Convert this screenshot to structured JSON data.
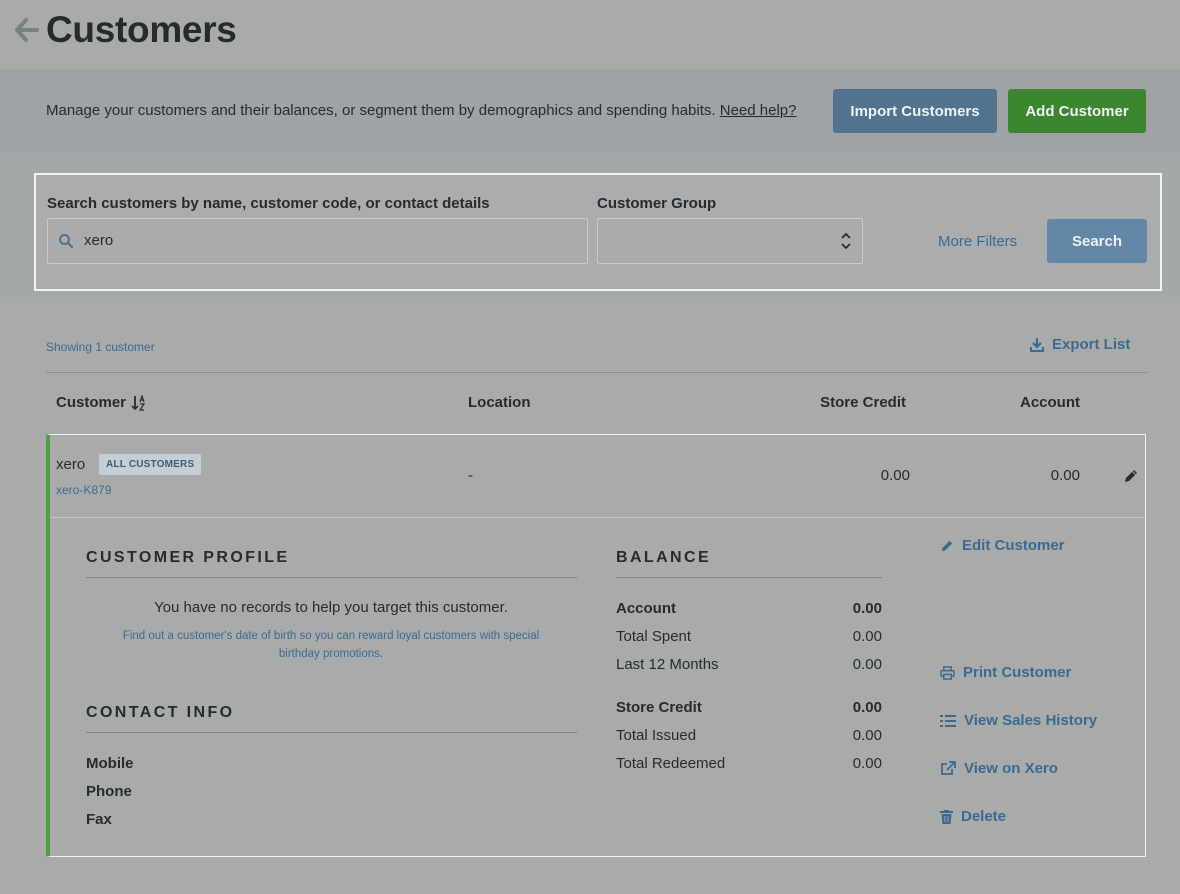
{
  "header": {
    "title": "Customers"
  },
  "intro": {
    "text": "Manage your customers and their balances, or segment them by demographics and spending habits.",
    "help_link": "Need help?",
    "import_label": "Import Customers",
    "add_label": "Add Customer"
  },
  "filters": {
    "search_label": "Search customers by name, customer code, or contact details",
    "search_value": "xero",
    "group_label": "Customer Group",
    "group_value": "",
    "more_filters": "More Filters",
    "search_button": "Search"
  },
  "list": {
    "showing": "Showing 1 customer",
    "export": "Export List",
    "columns": {
      "customer": "Customer",
      "location": "Location",
      "store_credit": "Store Credit",
      "account": "Account"
    }
  },
  "customer": {
    "name": "xero",
    "group_badge": "ALL CUSTOMERS",
    "code": "xero-K879",
    "location": "-",
    "store_credit": "0.00",
    "account": "0.00",
    "profile": {
      "title": "CUSTOMER PROFILE",
      "no_records": "You have no records to help you target this customer.",
      "tip": "Find out a customer's date of birth so you can reward loyal customers with special birthday promotions."
    },
    "contact": {
      "title": "CONTACT INFO",
      "labels": [
        "Mobile",
        "Phone",
        "Fax"
      ]
    },
    "balance": {
      "title": "BALANCE",
      "account_label": "Account",
      "account_value": "0.00",
      "total_spent_label": "Total Spent",
      "total_spent_value": "0.00",
      "last12_label": "Last 12 Months",
      "last12_value": "0.00",
      "store_credit_label": "Store Credit",
      "store_credit_value": "0.00",
      "issued_label": "Total Issued",
      "issued_value": "0.00",
      "redeemed_label": "Total Redeemed",
      "redeemed_value": "0.00"
    },
    "actions": {
      "edit": "Edit Customer",
      "print": "Print Customer",
      "history": "View Sales History",
      "xero": "View on Xero",
      "delete": "Delete"
    }
  },
  "colors": {
    "primary_button": "#52728e",
    "add_button": "#3c8630",
    "link": "#3b6a90",
    "card_accent": "#4fa043"
  },
  "icons": [
    "back-arrow-icon",
    "search-icon",
    "spinner-arrows-icon",
    "download-icon",
    "sort-alpha-icon",
    "pencil-icon",
    "printer-icon",
    "list-icon",
    "external-link-icon",
    "trash-icon"
  ]
}
